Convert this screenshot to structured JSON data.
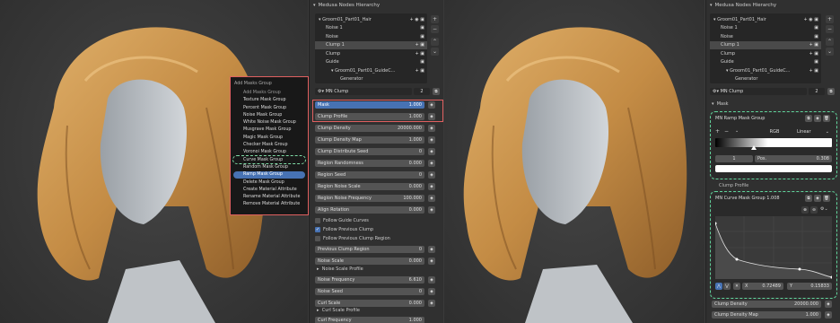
{
  "left_panel": {
    "header": "Medusa Nodes Hierarchy",
    "tree": [
      {
        "label": "Groom01_Part01_Hair",
        "indent": 0
      },
      {
        "label": "Noise 1",
        "indent": 1
      },
      {
        "label": "Noise",
        "indent": 1
      },
      {
        "label": "Clump 1",
        "indent": 1,
        "selected": true
      },
      {
        "label": "Clump",
        "indent": 1
      },
      {
        "label": "Guide",
        "indent": 1
      },
      {
        "label": "Groom01_Part01_GuideC...",
        "indent": 2
      },
      {
        "label": "Generator",
        "indent": 3
      }
    ],
    "node_name": "MN Clump",
    "node_users": "2",
    "props": [
      {
        "label": "Mask",
        "value": "1.000",
        "highlight": true
      },
      {
        "label": "Clump Profile",
        "value": "1.000"
      },
      {
        "label": "Clump Density",
        "value": "20000.000"
      },
      {
        "label": "Clump Density Map",
        "value": "1.000"
      },
      {
        "label": "Clump Distribute Seed",
        "value": "0"
      },
      {
        "label": "Region Randomness",
        "value": "0.000"
      },
      {
        "label": "Region Seed",
        "value": "0"
      },
      {
        "label": "Region Noise Scale",
        "value": "0.000"
      },
      {
        "label": "Region Noise Frequency",
        "value": "100.000"
      },
      {
        "label": "Align Rotation",
        "value": "0.000"
      }
    ],
    "checks": [
      {
        "label": "Follow Guide Curves",
        "on": false
      },
      {
        "label": "Follow Previous Clump",
        "on": true
      },
      {
        "label": "Follow Previous Clump Region",
        "on": false
      }
    ],
    "props2": [
      {
        "label": "Previous Clump Region",
        "value": "0"
      },
      {
        "label": "Noise Scale",
        "value": "0.000"
      }
    ],
    "noise_profile": "Noise Scale Profile",
    "props3": [
      {
        "label": "Noise Frequency",
        "value": "6.610"
      },
      {
        "label": "Noise Seed",
        "value": "0"
      },
      {
        "label": "Curl Scale",
        "value": "0.000"
      }
    ],
    "curl_profile": "Curl Scale Profile",
    "curl_freq": "Curl Frequency",
    "curl_freq_value": "1.000"
  },
  "context_menu": {
    "title": "Add Masks Group",
    "subtitle": "Add Masks Group",
    "items": [
      "Texture Mask Group",
      "Percent Mask Group",
      "Noise Mask Group",
      "White Noise Mask Group",
      "Musgrave Mask Group",
      "Magic Mask Group",
      "Checker Mask Group",
      "Voronoi Mask Group",
      "Curve Mask Group",
      "Random Mask Group",
      "Ramp Mask Group",
      "Delete Mask Group",
      "Create Material Attribute",
      "Rename Material Attribute",
      "Remove Material Attribute"
    ]
  },
  "right_panel": {
    "header": "Medusa Nodes Hierarchy",
    "tree": [
      {
        "label": "Groom01_Part01_Hair",
        "indent": 0
      },
      {
        "label": "Noise 1",
        "indent": 1
      },
      {
        "label": "Noise",
        "indent": 1
      },
      {
        "label": "Clump 1",
        "indent": 1,
        "selected": true
      },
      {
        "label": "Clump",
        "indent": 1
      },
      {
        "label": "Guide",
        "indent": 1
      },
      {
        "label": "Groom01_Part01_GuideC...",
        "indent": 2
      },
      {
        "label": "Generator",
        "indent": 3
      }
    ],
    "node_name": "MN Clump",
    "node_users": "2",
    "mask_label": "Mask",
    "ramp": {
      "title": "MN Ramp Mask Group",
      "color_mode": "RGB",
      "interp": "Linear",
      "stop_index": "1",
      "pos_label": "Pos.",
      "pos_value": "0.308"
    },
    "clump_profile": "Clump Profile",
    "curve": {
      "title": "MN Curve Mask Group 1.008",
      "x_label": "X",
      "x_value": "0.72489",
      "y_label": "Y",
      "y_value": "0.15833"
    },
    "props": [
      {
        "label": "Clump Density",
        "value": "20000.000"
      },
      {
        "label": "Clump Density Map",
        "value": "1.000"
      }
    ]
  },
  "colors": {
    "accent": "#4772b3",
    "highlight_red": "#e06060",
    "highlight_green": "#5fd39a"
  }
}
